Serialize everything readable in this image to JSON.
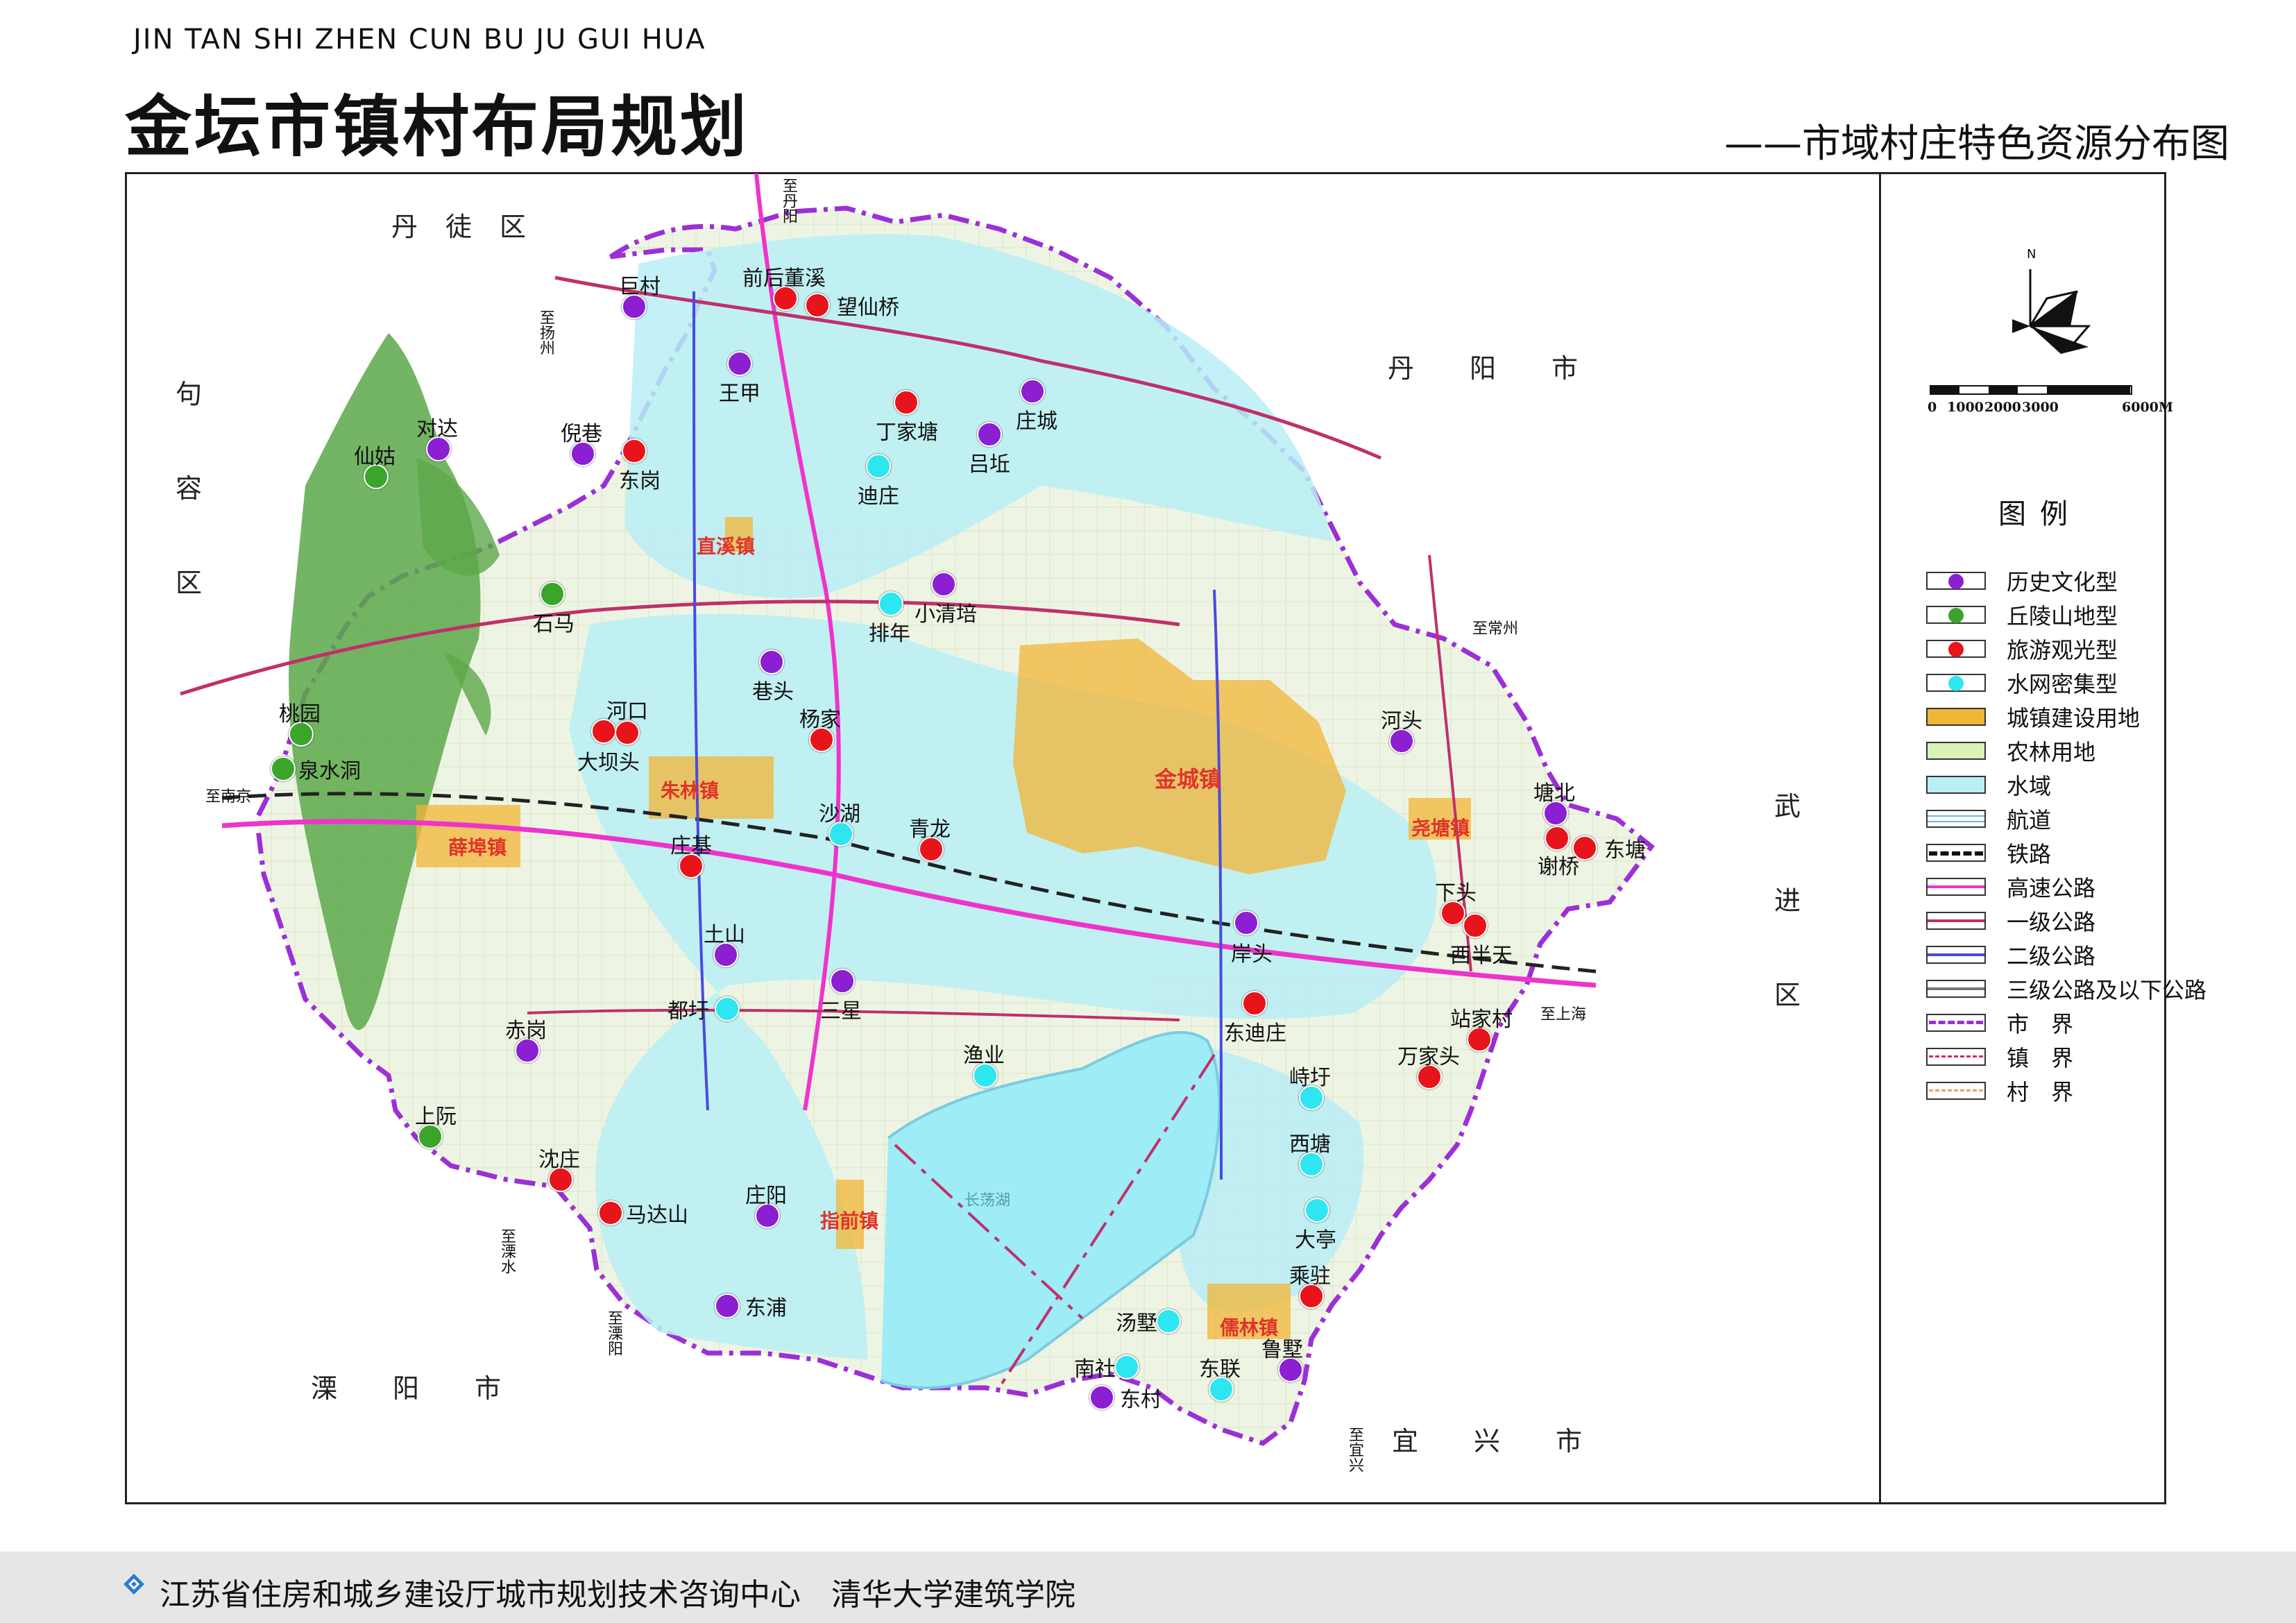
{
  "header": {
    "pinyin": "JIN TAN SHI ZHEN CUN BU JU GUI HUA",
    "title": "金坛市镇村布局规划",
    "subtitle": "——市域村庄特色资源分布图"
  },
  "colors": {
    "history": "#8c1fd1",
    "hilly": "#3aa52a",
    "tourism": "#e8141b",
    "water_network": "#2ee6f0",
    "urban": "#f2b636",
    "farmland": "#e6f4c9",
    "water": "#b9eef6",
    "green_hills": "#5ca84a",
    "town_label": "#e0342a"
  },
  "regions": {
    "dantu": "丹徒区",
    "jurong": "句容区",
    "danyang": "丹阳市",
    "wujin": "武进区",
    "liyang": "溧阳市",
    "yixing": "宜兴市"
  },
  "towns": [
    {
      "id": "zhixi",
      "name": "直溪镇"
    },
    {
      "id": "zhulin",
      "name": "朱林镇"
    },
    {
      "id": "xuebu",
      "name": "薛埠镇"
    },
    {
      "id": "jincheng",
      "name": "金城镇"
    },
    {
      "id": "yaotang",
      "name": "尧塘镇"
    },
    {
      "id": "zhiqian",
      "name": "指前镇"
    },
    {
      "id": "rulin",
      "name": "儒林镇"
    }
  ],
  "villages": [
    {
      "name": "巨村",
      "type": "history"
    },
    {
      "name": "前后董溪",
      "type": "tourism"
    },
    {
      "name": "望仙桥",
      "type": "tourism"
    },
    {
      "name": "王甲",
      "type": "history"
    },
    {
      "name": "丁家塘",
      "type": "tourism"
    },
    {
      "name": "庄城",
      "type": "history"
    },
    {
      "name": "吕坵",
      "type": "history"
    },
    {
      "name": "迪庄",
      "type": "water_network"
    },
    {
      "name": "对达",
      "type": "history"
    },
    {
      "name": "仙姑",
      "type": "hilly"
    },
    {
      "name": "倪巷",
      "type": "history"
    },
    {
      "name": "东岗",
      "type": "tourism"
    },
    {
      "name": "石马",
      "type": "hilly"
    },
    {
      "name": "小清培",
      "type": "history"
    },
    {
      "name": "排年",
      "type": "water_network"
    },
    {
      "name": "巷头",
      "type": "history"
    },
    {
      "name": "杨家",
      "type": "tourism"
    },
    {
      "name": "桃园",
      "type": "hilly"
    },
    {
      "name": "泉水洞",
      "type": "hilly"
    },
    {
      "name": "河口",
      "type": "tourism"
    },
    {
      "name": "大坝头",
      "type": "tourism"
    },
    {
      "name": "沙湖",
      "type": "water_network"
    },
    {
      "name": "青龙",
      "type": "tourism"
    },
    {
      "name": "庄基",
      "type": "tourism"
    },
    {
      "name": "河头",
      "type": "history"
    },
    {
      "name": "塘北",
      "type": "history"
    },
    {
      "name": "谢桥",
      "type": "tourism"
    },
    {
      "name": "东塘",
      "type": "tourism"
    },
    {
      "name": "下头",
      "type": "tourism"
    },
    {
      "name": "西半天",
      "type": "tourism"
    },
    {
      "name": "岸头",
      "type": "history"
    },
    {
      "name": "土山",
      "type": "history"
    },
    {
      "name": "三星",
      "type": "history"
    },
    {
      "name": "都圩",
      "type": "water_network"
    },
    {
      "name": "东迪庄",
      "type": "tourism"
    },
    {
      "name": "站家村",
      "type": "tourism"
    },
    {
      "name": "万家头",
      "type": "tourism"
    },
    {
      "name": "赤岗",
      "type": "history"
    },
    {
      "name": "渔业",
      "type": "water_network"
    },
    {
      "name": "峙圩",
      "type": "water_network"
    },
    {
      "name": "上阮",
      "type": "hilly"
    },
    {
      "name": "西塘",
      "type": "water_network"
    },
    {
      "name": "沈庄",
      "type": "tourism"
    },
    {
      "name": "马达山",
      "type": "tourism"
    },
    {
      "name": "庄阳",
      "type": "history"
    },
    {
      "name": "大亭",
      "type": "water_network"
    },
    {
      "name": "乘驻",
      "type": "tourism"
    },
    {
      "name": "东浦",
      "type": "history"
    },
    {
      "name": "汤墅",
      "type": "water_network"
    },
    {
      "name": "鲁墅",
      "type": "history"
    },
    {
      "name": "南社",
      "type": "water_network"
    },
    {
      "name": "东联",
      "type": "water_network"
    },
    {
      "name": "东村",
      "type": "history"
    }
  ],
  "road_notes": {
    "to_danyang": "至丹阳",
    "to_nanjing": "至南京",
    "to_yangzhou": "至扬州",
    "to_changzhou": "至常州",
    "to_shanghai": "至上海",
    "to_liyang": "至溧阳",
    "to_lishui": "至溧水",
    "to_yixing": "至宜兴",
    "lake": "长荡湖"
  },
  "compass": {
    "north": "N"
  },
  "scale": {
    "labels": [
      "0",
      "1000",
      "2000",
      "3000",
      "6000M"
    ]
  },
  "legend": {
    "title": "图例",
    "items": [
      {
        "kind": "dot",
        "label": "历史文化型",
        "color": "#8c1fd1"
      },
      {
        "kind": "dot",
        "label": "丘陵山地型",
        "color": "#3aa52a"
      },
      {
        "kind": "dot",
        "label": "旅游观光型",
        "color": "#e8141b"
      },
      {
        "kind": "dot",
        "label": "水网密集型",
        "color": "#2ee6f0"
      },
      {
        "kind": "fill",
        "label": "城镇建设用地",
        "color": "#f2b636"
      },
      {
        "kind": "fill",
        "label": "农林用地",
        "color": "#d9f2b8"
      },
      {
        "kind": "fill",
        "label": "水域",
        "color": "#b9eef6"
      },
      {
        "kind": "waterway",
        "label": "航道",
        "color": "#6ab8d8"
      },
      {
        "kind": "rail",
        "label": "铁路",
        "color": "#111111"
      },
      {
        "kind": "line",
        "label": "高速公路",
        "color": "#ee33cc"
      },
      {
        "kind": "line",
        "label": "一级公路",
        "color": "#c0306a"
      },
      {
        "kind": "line",
        "label": "二级公路",
        "color": "#4a4ae0"
      },
      {
        "kind": "line",
        "label": "三级公路及以下公路",
        "color": "#777777"
      },
      {
        "kind": "dashdot",
        "label": "市　界",
        "color": "#9c2fd6"
      },
      {
        "kind": "dash",
        "label": "镇　界",
        "color": "#e0245a"
      },
      {
        "kind": "dash",
        "label": "村　界",
        "color": "#f0a060"
      }
    ]
  },
  "footer": {
    "text": "江苏省住房和城乡建设厅城市规划技术咨询中心　清华大学建筑学院"
  }
}
